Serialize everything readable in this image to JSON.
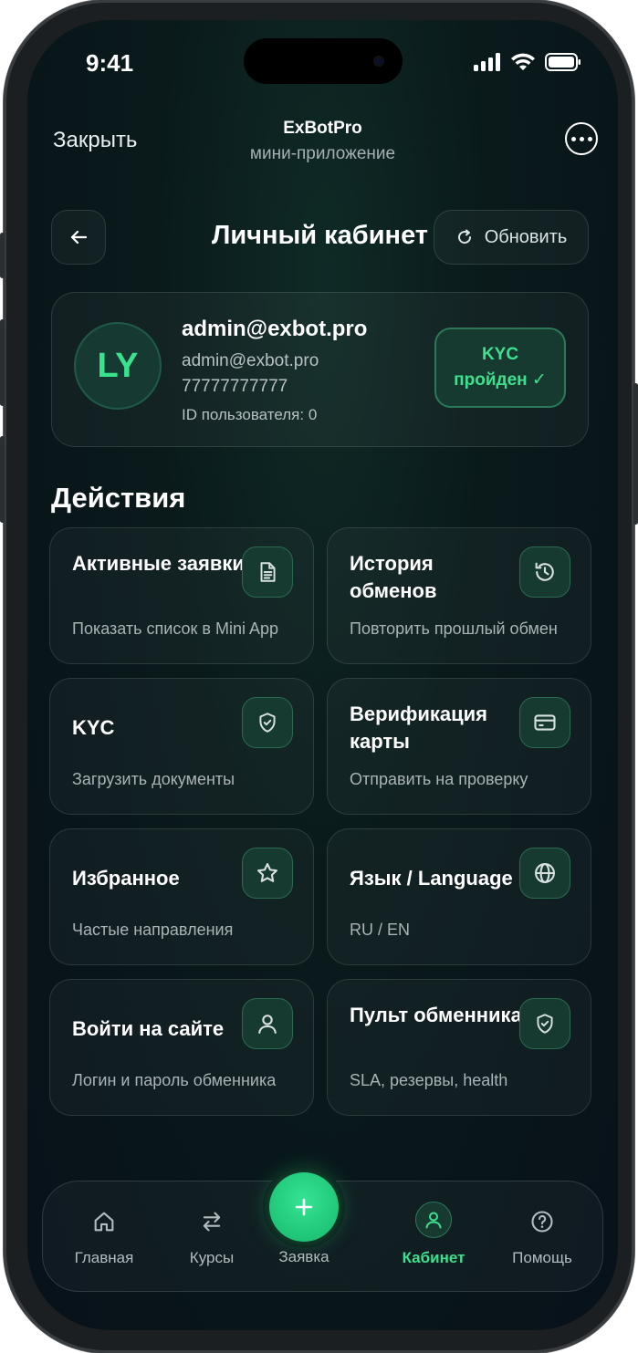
{
  "status": {
    "time": "9:41"
  },
  "topbar": {
    "close_label": "Закрыть",
    "app_name": "ExBotPro",
    "app_subtitle": "мини-приложение"
  },
  "header": {
    "title": "Личный кабинет",
    "refresh_label": "Обновить"
  },
  "profile": {
    "initials": "LY",
    "name": "admin@exbot.pro",
    "email": "admin@exbot.pro",
    "phone": "77777777777",
    "user_id": "ID пользователя: 0",
    "kyc_line1": "KYC",
    "kyc_line2": "пройден ✓"
  },
  "actions": {
    "section_title": "Действия",
    "tiles": [
      {
        "title": "Активные заявки",
        "desc": "Показать список в Mini App",
        "icon": "document-icon"
      },
      {
        "title": "История обменов",
        "desc": "Повторить прошлый обмен",
        "icon": "history-icon"
      },
      {
        "title": "KYC",
        "desc": "Загрузить документы",
        "icon": "shield-check-icon"
      },
      {
        "title": "Верификация карты",
        "desc": "Отправить на проверку",
        "icon": "card-icon"
      },
      {
        "title": "Избранное",
        "desc": "Частые направления",
        "icon": "star-icon"
      },
      {
        "title": "Язык / Language",
        "desc": "RU / EN",
        "icon": "globe-icon"
      },
      {
        "title": "Войти на сайте",
        "desc": "Логин и пароль обменника",
        "icon": "user-icon"
      },
      {
        "title": "Пульт обменника",
        "desc": "SLA, резервы, health",
        "icon": "shield-check-icon"
      }
    ]
  },
  "tabbar": {
    "tabs": [
      {
        "label": "Главная",
        "icon": "home-icon"
      },
      {
        "label": "Курсы",
        "icon": "swap-icon"
      },
      {
        "label": "Заявка",
        "icon": "plus-icon"
      },
      {
        "label": "Кабинет",
        "icon": "user-icon",
        "active": true
      },
      {
        "label": "Помощь",
        "icon": "help-icon"
      }
    ]
  },
  "colors": {
    "accent": "#3ee08f",
    "background": "#0a1a1b"
  }
}
